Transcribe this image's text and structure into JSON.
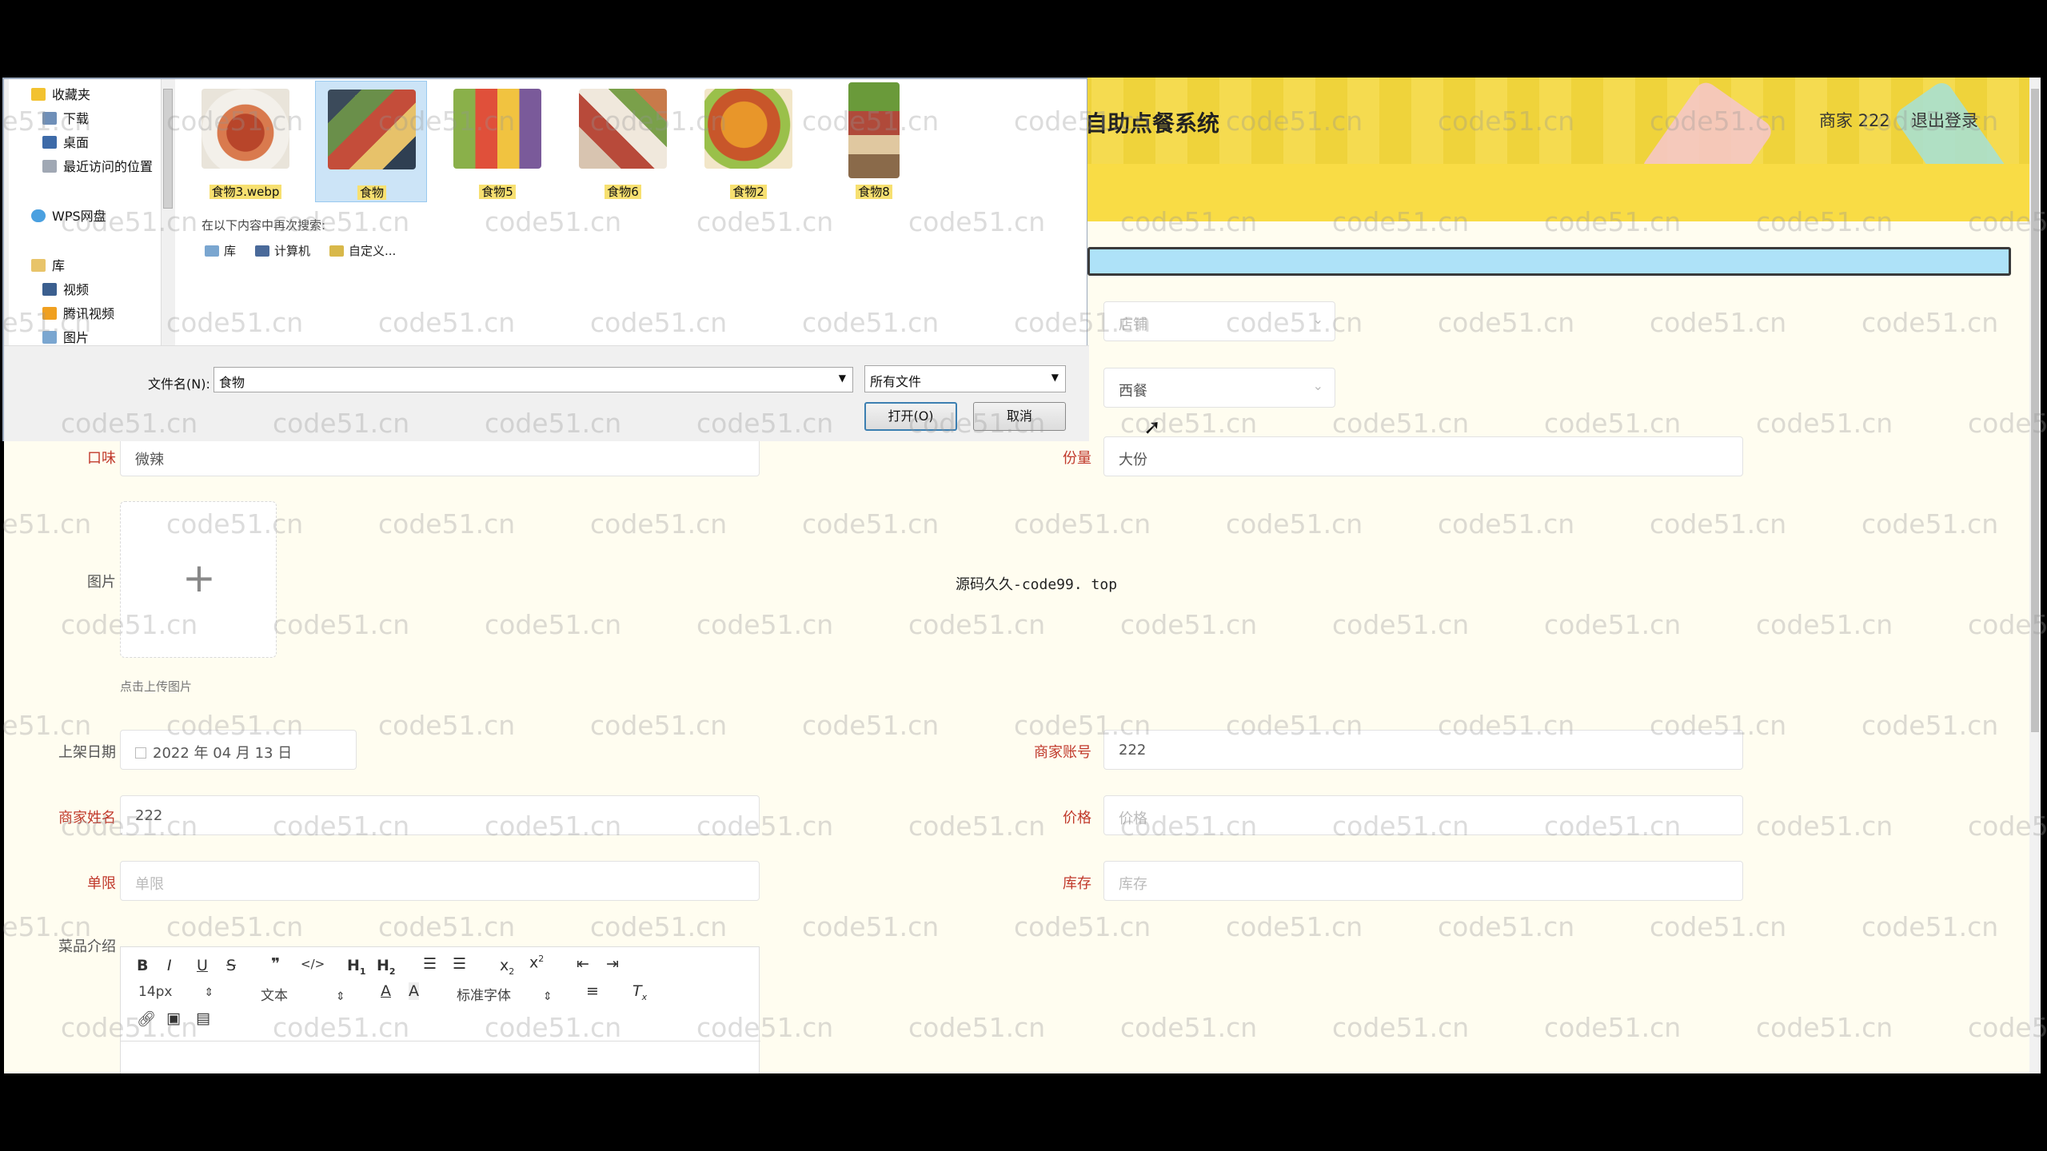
{
  "header": {
    "title": "自助点餐系统",
    "user": "商家 222",
    "logout": "退出登录"
  },
  "form": {
    "shop": {
      "placeholder": "店铺"
    },
    "category": {
      "value": "西餐"
    },
    "taste": {
      "label": "口味",
      "value": "微辣"
    },
    "portion": {
      "label": "份量",
      "value": "大份"
    },
    "image": {
      "label": "图片",
      "tip": "点击上传图片"
    },
    "center_note": "源码久久-code99. top",
    "list_date": {
      "label": "上架日期",
      "value": "2022 年 04 月 13 日"
    },
    "merchant_account": {
      "label": "商家账号",
      "value": "222"
    },
    "merchant_name": {
      "label": "商家姓名",
      "value": "222"
    },
    "price": {
      "label": "价格",
      "placeholder": "价格"
    },
    "limit": {
      "label": "单限",
      "placeholder": "单限"
    },
    "stock": {
      "label": "库存",
      "placeholder": "库存"
    },
    "intro": {
      "label": "菜品介绍"
    }
  },
  "editor": {
    "font_size": "14px",
    "text_type": "文本",
    "font_family": "标准字体"
  },
  "file_dialog": {
    "nav": {
      "favorites": "收藏夹",
      "downloads": "下载",
      "desktop": "桌面",
      "recent": "最近访问的位置",
      "wps": "WPS网盘",
      "library": "库",
      "video": "视频",
      "tencent_video": "腾讯视频",
      "pictures": "图片"
    },
    "files": [
      {
        "name": "食物3.webp"
      },
      {
        "name": "食物"
      },
      {
        "name": "食物5"
      },
      {
        "name": "食物6"
      },
      {
        "name": "食物2"
      },
      {
        "name": "食物8"
      }
    ],
    "search_again": "在以下内容中再次搜索:",
    "locations": {
      "lib": "库",
      "computer": "计算机",
      "custom": "自定义..."
    },
    "filename_label": "文件名(N):",
    "filename_value": "食物",
    "filetype": "所有文件",
    "open": "打开(O)",
    "cancel": "取消"
  },
  "watermark": "code51.cn",
  "colors": {
    "header": "#f4d73c",
    "required_label": "#c0392b",
    "page_bg": "#fffdf0"
  }
}
